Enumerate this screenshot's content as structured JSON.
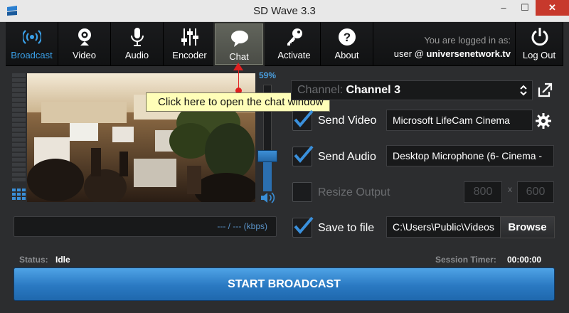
{
  "window": {
    "title": "SD Wave 3.3",
    "minimize": "–",
    "maximize": "☐",
    "close": "✕"
  },
  "toolbar": {
    "items": [
      {
        "label": "Broadcast",
        "icon": "broadcast-icon"
      },
      {
        "label": "Video",
        "icon": "webcam-icon"
      },
      {
        "label": "Audio",
        "icon": "microphone-icon"
      },
      {
        "label": "Encoder",
        "icon": "sliders-icon"
      },
      {
        "label": "Chat",
        "icon": "chat-bubble-icon"
      },
      {
        "label": "Activate",
        "icon": "key-icon"
      },
      {
        "label": "About",
        "icon": "question-icon"
      }
    ],
    "logged_in_label": "You are logged in as:",
    "user_prefix": "user @ ",
    "user_domain": "universenetwork.tv",
    "logout_label": "Log Out"
  },
  "preview": {
    "volume_percent": "59%",
    "volume_level": 0.59,
    "bitrate": "--- / --- (kbps)"
  },
  "tooltip": {
    "text": "Click here to open the chat window"
  },
  "controls": {
    "channel_label": "Channel:",
    "channel_value": "Channel 3",
    "send_video": {
      "label": "Send Video",
      "checked": true,
      "value": "Microsoft LifeCam Cinema"
    },
    "send_audio": {
      "label": "Send Audio",
      "checked": true,
      "value": "Desktop Microphone (6- Cinema - "
    },
    "resize_output": {
      "label": "Resize Output",
      "checked": false,
      "width": "800",
      "separator": "x",
      "height": "600"
    },
    "save_to_file": {
      "label": "Save to file",
      "checked": true,
      "value": "C:\\Users\\Public\\Videos",
      "browse_label": "Browse"
    }
  },
  "status": {
    "status_label": "Status:",
    "status_value": "Idle",
    "timer_label": "Session Timer:",
    "timer_value": "00:00:00"
  },
  "start_button": "START BROADCAST",
  "colors": {
    "accent": "#3aa0e8",
    "start_button": "#2a79c2",
    "tooltip_bg": "#fffeb8",
    "pointer": "#e02020"
  }
}
